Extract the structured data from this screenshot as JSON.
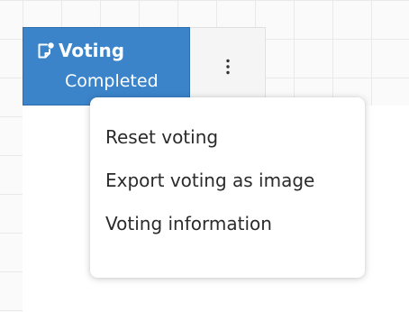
{
  "voting": {
    "title": "Voting",
    "status": "Completed",
    "title_icon": "note-icon",
    "more_icon": "kebab-icon"
  },
  "menu": {
    "items": [
      {
        "label": "Reset voting"
      },
      {
        "label": "Export voting as image"
      },
      {
        "label": "Voting information"
      }
    ]
  },
  "colors": {
    "voting_bg": "#3b84c9",
    "menu_text": "#2b2b2b"
  }
}
